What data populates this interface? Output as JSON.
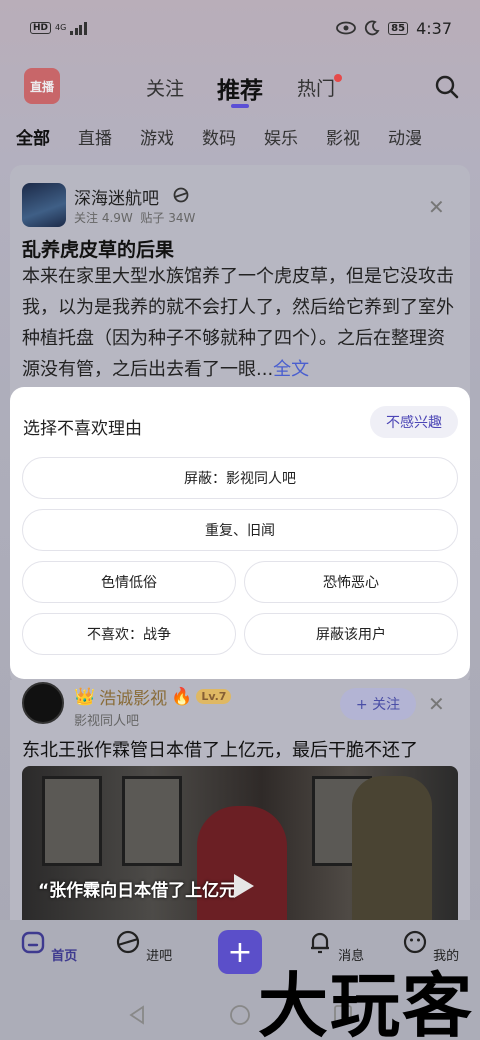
{
  "status": {
    "hd": "HD",
    "network": "4G",
    "battery": "85",
    "time": "4:37"
  },
  "top_nav": {
    "logo_text": "直播",
    "tabs": [
      {
        "label": "关注"
      },
      {
        "label": "推荐"
      },
      {
        "label": "热门"
      }
    ]
  },
  "categories": [
    "全部",
    "直播",
    "游戏",
    "数码",
    "娱乐",
    "影视",
    "动漫"
  ],
  "post": {
    "forum_name": "深海迷航吧",
    "follow_count": "关注 4.9W",
    "post_count": "贴子 34W",
    "title": "乱养虎皮草的后果",
    "body": "本来在家里大型水族馆养了一个虎皮草，但是它没攻击我，以为是我养的就不会打人了，然后给它养到了室外种植托盘（因为种子不够就种了四个）。之后在整理资源没有管，之后出去看了一眼...",
    "more": "全文"
  },
  "popup": {
    "title": "选择不喜欢理由",
    "not_interested": "不感兴趣",
    "reasons": [
      "屏蔽：影视同人吧",
      "重复、旧闻",
      "色情低俗",
      "恐怖恶心",
      "不喜欢：战争",
      "屏蔽该用户"
    ]
  },
  "video_post": {
    "user_name": "浩诚影视",
    "level": "Lv.7",
    "sub": "影视同人吧",
    "follow": "+ 关注",
    "title": "东北王张作霖管日本借了上亿元，最后干脆不还了",
    "caption": "“张作霖向日本借了上亿元”"
  },
  "bottom_tabs": [
    {
      "label": "首页"
    },
    {
      "label": "进吧"
    },
    {
      "label": "消息"
    },
    {
      "label": "我的"
    }
  ],
  "post_button": "+",
  "watermark": "大玩客",
  "colors": {
    "accent": "#5b4fc9",
    "link": "#4a5fcf",
    "hot_dot": "#e54a4a"
  }
}
